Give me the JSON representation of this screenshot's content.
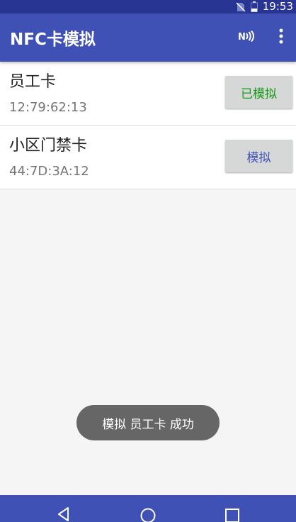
{
  "status_bar": {
    "time": "19:53",
    "icons": [
      "no-sim-icon",
      "battery-icon"
    ]
  },
  "app_bar": {
    "title": "NFC卡模拟",
    "actions": [
      "nfc-icon",
      "more-vert-icon"
    ]
  },
  "cards": [
    {
      "name": "员工卡",
      "id": "12:79:62:13",
      "button_label": "已模拟",
      "button_color": "#1a9a1a"
    },
    {
      "name": "小区门禁卡",
      "id": "44:7D:3A:12",
      "button_label": "模拟",
      "button_color": "#3f51b5"
    }
  ],
  "toast": {
    "message": "模拟 员工卡 成功"
  },
  "nav_bar": {
    "buttons": [
      "back-icon",
      "home-icon",
      "recent-apps-icon"
    ]
  },
  "colors": {
    "primary": "#3f51b5",
    "primary_dark": "#283593",
    "active_green": "#1a9a1a"
  }
}
